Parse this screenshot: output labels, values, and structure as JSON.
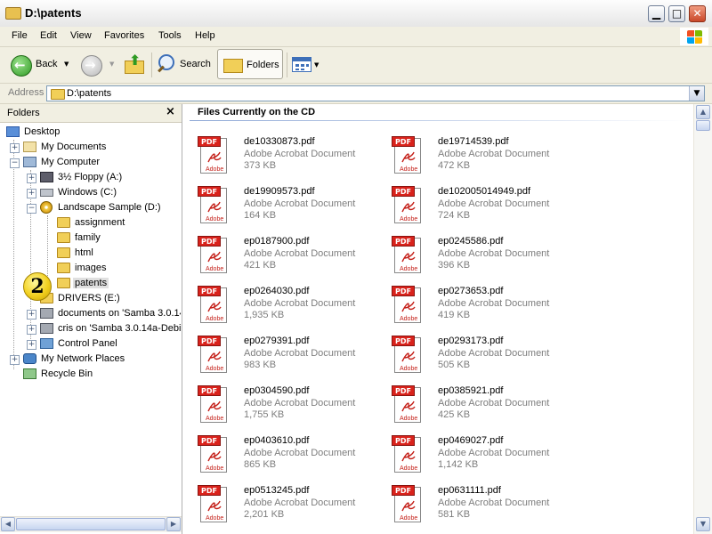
{
  "window": {
    "title": "D:\\patents"
  },
  "menu": [
    "File",
    "Edit",
    "View",
    "Favorites",
    "Tools",
    "Help"
  ],
  "toolbar": {
    "back_label": "Back",
    "search_label": "Search",
    "folders_label": "Folders"
  },
  "address": {
    "label": "Address",
    "value": "D:\\patents"
  },
  "folders_pane": {
    "title": "Folders",
    "tree": [
      {
        "label": "Desktop",
        "icon": "desktop-icon"
      },
      {
        "label": "My Documents",
        "icon": "documents-icon"
      },
      {
        "label": "My Computer",
        "icon": "computer-icon"
      },
      {
        "label": "3½ Floppy (A:)",
        "icon": "floppy-icon"
      },
      {
        "label": "Windows (C:)",
        "icon": "drive-icon"
      },
      {
        "label": "Landscape Sample (D:)",
        "icon": "cd-icon"
      },
      {
        "label": "assignment",
        "icon": "folder-icon"
      },
      {
        "label": "family",
        "icon": "folder-icon"
      },
      {
        "label": "html",
        "icon": "folder-icon"
      },
      {
        "label": "images",
        "icon": "folder-icon"
      },
      {
        "label": "patents",
        "icon": "folder-icon",
        "selected": true
      },
      {
        "label": "DRIVERS (E:)",
        "icon": "folder-icon"
      },
      {
        "label": "documents on 'Samba 3.0.14",
        "icon": "network-drive-icon"
      },
      {
        "label": "cris on 'Samba 3.0.14a-Debia",
        "icon": "network-drive-icon"
      },
      {
        "label": "Control Panel",
        "icon": "control-panel-icon"
      },
      {
        "label": "My Network Places",
        "icon": "network-places-icon"
      },
      {
        "label": "Recycle Bin",
        "icon": "recycle-bin-icon"
      }
    ]
  },
  "annotation": {
    "step": "2"
  },
  "content": {
    "heading": "Files Currently on the CD",
    "file_type": "Adobe Acrobat Document",
    "icon_tag": "PDF",
    "icon_brand": "Adobe",
    "files": [
      {
        "name": "de10330873.pdf",
        "size": "373 KB"
      },
      {
        "name": "de19714539.pdf",
        "size": "472 KB"
      },
      {
        "name": "de19909573.pdf",
        "size": "164 KB"
      },
      {
        "name": "de102005014949.pdf",
        "size": "724 KB"
      },
      {
        "name": "ep0187900.pdf",
        "size": "421 KB"
      },
      {
        "name": "ep0245586.pdf",
        "size": "396 KB"
      },
      {
        "name": "ep0264030.pdf",
        "size": "1,935 KB"
      },
      {
        "name": "ep0273653.pdf",
        "size": "419 KB"
      },
      {
        "name": "ep0279391.pdf",
        "size": "983 KB"
      },
      {
        "name": "ep0293173.pdf",
        "size": "505 KB"
      },
      {
        "name": "ep0304590.pdf",
        "size": "1,755 KB"
      },
      {
        "name": "ep0385921.pdf",
        "size": "425 KB"
      },
      {
        "name": "ep0403610.pdf",
        "size": "865 KB"
      },
      {
        "name": "ep0469027.pdf",
        "size": "1,142 KB"
      },
      {
        "name": "ep0513245.pdf",
        "size": "2,201 KB"
      },
      {
        "name": "ep0631111.pdf",
        "size": "581 KB"
      }
    ]
  },
  "colors": {
    "accent": "#316ac5",
    "pdf_red": "#d9221b",
    "selection": "#e0e0e0"
  }
}
